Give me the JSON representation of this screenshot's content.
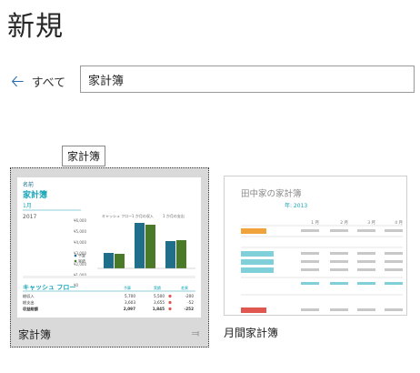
{
  "page": {
    "title": "新規"
  },
  "nav": {
    "back_label": "すべて"
  },
  "search": {
    "value": "家計簿"
  },
  "tooltip": {
    "text": "家計簿"
  },
  "templates": [
    {
      "label": "家計簿",
      "preview": {
        "name_label": "名前",
        "title": "家計簿",
        "month": "1月",
        "year": "2017",
        "chart_headers": [
          "キャッシュ フロー",
          "1 か月の収入",
          "1 か月の支出"
        ],
        "y_ticks": [
          "¥6,000",
          "¥5,000",
          "¥4,000",
          "¥3,000",
          "¥2,000",
          "¥1,000",
          "¥0"
        ],
        "legend": [
          "予算",
          "実績"
        ],
        "cashflow_title": "キャッシュ フロー",
        "cashflow_headers": [
          "予算",
          "実績",
          "差異"
        ],
        "rows": [
          {
            "label": "総収入",
            "budget": "5,700",
            "actual": "5,500",
            "diff": "-200"
          },
          {
            "label": "総支出",
            "budget": "3,603",
            "actual": "3,655",
            "diff": "-52"
          },
          {
            "label": "収益総額",
            "budget": "2,097",
            "actual": "1,845",
            "diff": "-252"
          }
        ]
      }
    },
    {
      "label": "月間家計簿",
      "preview": {
        "title": "田中家の家計簿",
        "year": "年: 2013",
        "months": [
          "1 月",
          "2 月",
          "3 月",
          "4 月"
        ]
      }
    }
  ],
  "colors": {
    "accent": "#2b6cb0",
    "teal": "#1aa6b7",
    "dark_teal": "#1f6f8b",
    "green": "#4a7a27",
    "orange": "#f0a23b",
    "red": "#e0574f"
  }
}
